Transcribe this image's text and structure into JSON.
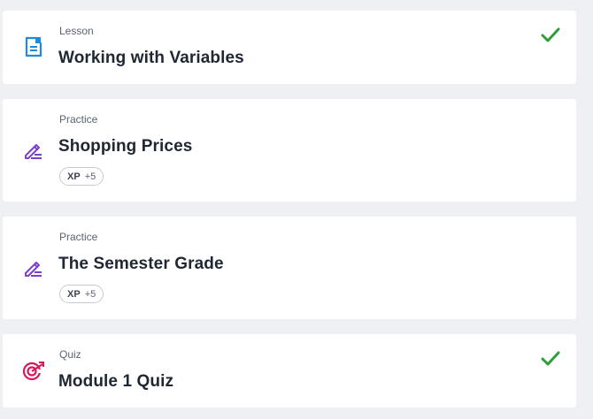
{
  "items": [
    {
      "kind": "Lesson",
      "title": "Working with Variables",
      "icon": "document-icon",
      "icon_color": "#1f8ad6",
      "completed": true
    },
    {
      "kind": "Practice",
      "title": "Shopping Prices",
      "icon": "pencil-icon",
      "icon_color": "#7b3fd1",
      "xp_label": "XP",
      "xp_value": "+5",
      "completed": false
    },
    {
      "kind": "Practice",
      "title": "The Semester Grade",
      "icon": "pencil-icon",
      "icon_color": "#7b3fd1",
      "xp_label": "XP",
      "xp_value": "+5",
      "completed": false
    },
    {
      "kind": "Quiz",
      "title": "Module 1 Quiz",
      "icon": "target-icon",
      "icon_color": "#d6185f",
      "completed": true
    }
  ],
  "colors": {
    "check": "#2e9e3a",
    "background": "#eef0f3"
  }
}
